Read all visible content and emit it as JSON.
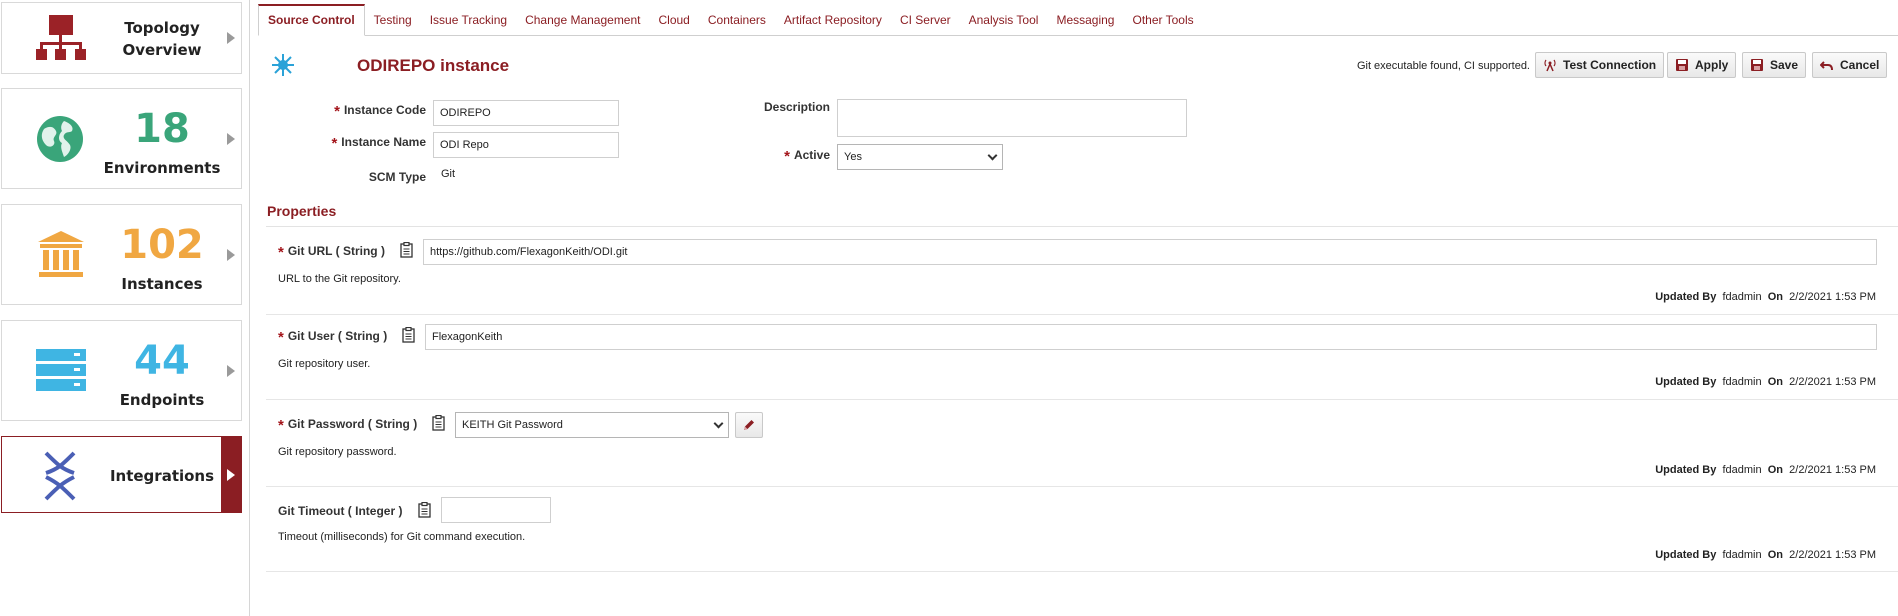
{
  "sidebar": {
    "topology": {
      "label_line1": "Topology",
      "label_line2": "Overview",
      "icon": "topology-icon"
    },
    "environments": {
      "count": "18",
      "label": "Environments",
      "icon": "globe-icon",
      "color": "#3aa57a"
    },
    "instances": {
      "count": "102",
      "label": "Instances",
      "icon": "building-icon",
      "color": "#f0a742"
    },
    "endpoints": {
      "count": "44",
      "label": "Endpoints",
      "icon": "server-icon",
      "color": "#3fb5e3"
    },
    "integrations": {
      "label": "Integrations",
      "icon": "integrations-icon",
      "active": true
    }
  },
  "tabs": [
    {
      "label": "Source Control",
      "active": true
    },
    {
      "label": "Testing"
    },
    {
      "label": "Issue Tracking"
    },
    {
      "label": "Change Management"
    },
    {
      "label": "Cloud"
    },
    {
      "label": "Containers"
    },
    {
      "label": "Artifact Repository"
    },
    {
      "label": "CI Server"
    },
    {
      "label": "Analysis Tool"
    },
    {
      "label": "Messaging"
    },
    {
      "label": "Other Tools"
    }
  ],
  "header": {
    "title": "ODIREPO instance",
    "status": "Git executable found, CI supported.",
    "buttons": {
      "test_connection": "Test Connection",
      "apply": "Apply",
      "save": "Save",
      "cancel": "Cancel"
    }
  },
  "form": {
    "instance_code": {
      "label": "Instance Code",
      "value": "ODIREPO"
    },
    "instance_name": {
      "label": "Instance Name",
      "value": "ODI Repo"
    },
    "scm_type": {
      "label": "SCM Type",
      "value": "Git"
    },
    "description": {
      "label": "Description",
      "value": ""
    },
    "active": {
      "label": "Active",
      "value": "Yes"
    }
  },
  "properties": {
    "title": "Properties",
    "items": [
      {
        "label": "Git URL ( String )",
        "value": "https://github.com/FlexagonKeith/ODI.git",
        "description": "URL to the Git repository.",
        "updated_by_label": "Updated By",
        "updated_by": "fdadmin",
        "on_label": "On",
        "updated_on": "2/2/2021 1:53 PM"
      },
      {
        "label": "Git User ( String )",
        "value": "FlexagonKeith",
        "description": "Git repository user.",
        "updated_by_label": "Updated By",
        "updated_by": "fdadmin",
        "on_label": "On",
        "updated_on": "2/2/2021 1:53 PM"
      },
      {
        "label": "Git Password ( String )",
        "value": "KEITH Git Password",
        "description": "Git repository password.",
        "updated_by_label": "Updated By",
        "updated_by": "fdadmin",
        "on_label": "On",
        "updated_on": "2/2/2021 1:53 PM"
      },
      {
        "label": "Git Timeout ( Integer )",
        "value": "",
        "description": "Timeout (milliseconds) for Git command execution.",
        "updated_by_label": "Updated By",
        "updated_by": "fdadmin",
        "on_label": "On",
        "updated_on": "2/2/2021 1:53 PM"
      }
    ]
  },
  "colors": {
    "accent": "#8b1e23",
    "required": "#a3141a"
  }
}
